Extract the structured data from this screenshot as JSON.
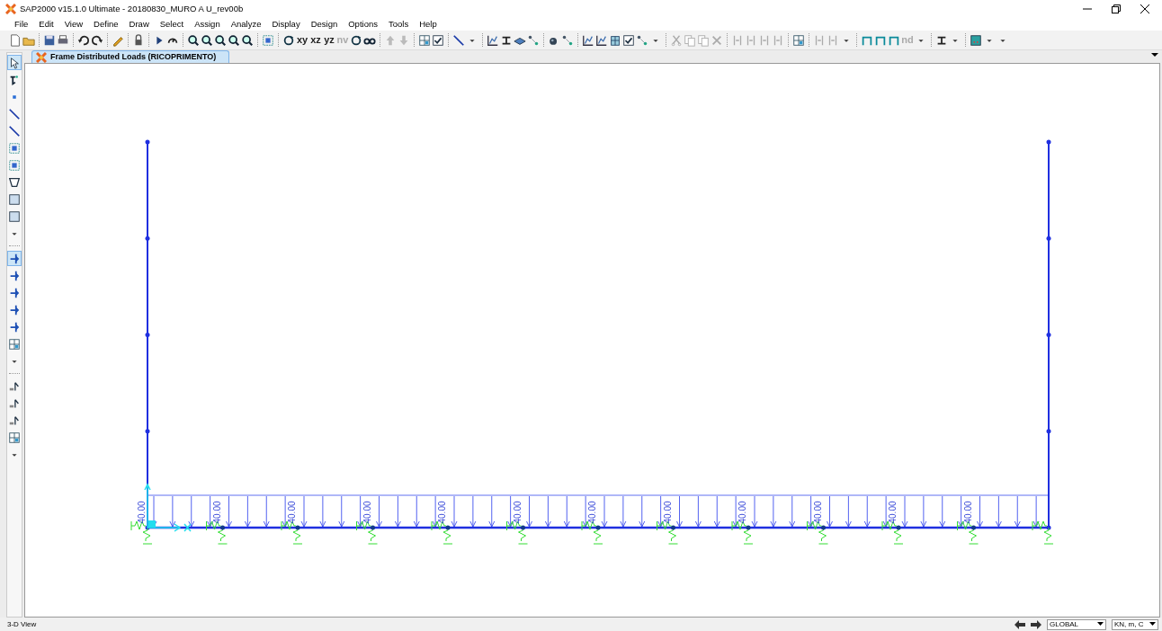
{
  "window": {
    "title": "SAP2000 v15.1.0 Ultimate  - 20180830_MURO A U_rev00b"
  },
  "menu": [
    "File",
    "Edit",
    "View",
    "Define",
    "Draw",
    "Select",
    "Assign",
    "Analyze",
    "Display",
    "Design",
    "Options",
    "Tools",
    "Help"
  ],
  "toolbar": [
    {
      "kind": "doc"
    },
    {
      "kind": "folder"
    },
    {
      "kind": "sep"
    },
    {
      "kind": "disk"
    },
    {
      "kind": "printer"
    },
    {
      "kind": "sep"
    },
    {
      "kind": "undo"
    },
    {
      "kind": "redo"
    },
    {
      "kind": "sep"
    },
    {
      "kind": "pencil"
    },
    {
      "kind": "sep"
    },
    {
      "kind": "lock"
    },
    {
      "kind": "sep"
    },
    {
      "kind": "play"
    },
    {
      "kind": "gauge"
    },
    {
      "kind": "sep"
    },
    {
      "kind": "zoom"
    },
    {
      "kind": "zoom"
    },
    {
      "kind": "zoom"
    },
    {
      "kind": "zoom"
    },
    {
      "kind": "zoom"
    },
    {
      "kind": "sep"
    },
    {
      "kind": "frame"
    },
    {
      "kind": "sep"
    },
    {
      "kind": "rotate"
    },
    {
      "kind": "text",
      "label": "xy",
      "disabled": false
    },
    {
      "kind": "text",
      "label": "xz",
      "disabled": false
    },
    {
      "kind": "text",
      "label": "yz",
      "disabled": false
    },
    {
      "kind": "text",
      "label": "nv",
      "disabled": true
    },
    {
      "kind": "rotate"
    },
    {
      "kind": "glasses"
    },
    {
      "kind": "sep"
    },
    {
      "kind": "up"
    },
    {
      "kind": "down"
    },
    {
      "kind": "sep"
    },
    {
      "kind": "grid"
    },
    {
      "kind": "check"
    },
    {
      "kind": "sep"
    },
    {
      "kind": "line"
    },
    {
      "kind": "caret"
    },
    {
      "kind": "sep"
    },
    {
      "kind": "chart"
    },
    {
      "kind": "ibeam"
    },
    {
      "kind": "layers"
    },
    {
      "kind": "nodes"
    },
    {
      "kind": "sep"
    },
    {
      "kind": "sphere"
    },
    {
      "kind": "nodes"
    },
    {
      "kind": "sep"
    },
    {
      "kind": "chart"
    },
    {
      "kind": "chart"
    },
    {
      "kind": "building"
    },
    {
      "kind": "check"
    },
    {
      "kind": "nodes"
    },
    {
      "kind": "caret"
    },
    {
      "kind": "sep"
    },
    {
      "kind": "scissors"
    },
    {
      "kind": "copy"
    },
    {
      "kind": "copy"
    },
    {
      "kind": "cross"
    },
    {
      "kind": "sep"
    },
    {
      "kind": "bars"
    },
    {
      "kind": "bars"
    },
    {
      "kind": "bars"
    },
    {
      "kind": "bars"
    },
    {
      "kind": "sep"
    },
    {
      "kind": "grid"
    },
    {
      "kind": "sep"
    },
    {
      "kind": "bars"
    },
    {
      "kind": "bars"
    },
    {
      "kind": "caret"
    },
    {
      "kind": "sep"
    },
    {
      "kind": "portal"
    },
    {
      "kind": "portal"
    },
    {
      "kind": "portal"
    },
    {
      "kind": "text",
      "label": "nd",
      "disabled": true
    },
    {
      "kind": "caret"
    },
    {
      "kind": "sep"
    },
    {
      "kind": "ibeam"
    },
    {
      "kind": "caret"
    },
    {
      "kind": "sep"
    },
    {
      "kind": "color"
    },
    {
      "kind": "caret"
    },
    {
      "kind": "caret"
    }
  ],
  "tab": {
    "label": "Frame Distributed Loads (RICOPRIMENTO)",
    "selected": true
  },
  "side_toolbar": [
    {
      "kind": "pointer",
      "selected": true
    },
    {
      "kind": "reshape",
      "selected": false
    },
    {
      "kind": "point",
      "selected": false
    },
    {
      "kind": "line",
      "selected": false
    },
    {
      "kind": "line",
      "selected": false
    },
    {
      "kind": "frame",
      "selected": false
    },
    {
      "kind": "frame",
      "selected": false
    },
    {
      "kind": "poly",
      "selected": false
    },
    {
      "kind": "square",
      "selected": false
    },
    {
      "kind": "square",
      "selected": false
    },
    {
      "kind": "caret",
      "selected": false
    },
    {
      "kind": "sep"
    },
    {
      "kind": "restraint",
      "selected": true
    },
    {
      "kind": "restraint",
      "selected": false
    },
    {
      "kind": "restraint",
      "selected": false
    },
    {
      "kind": "restraint",
      "selected": false
    },
    {
      "kind": "restraint",
      "selected": false
    },
    {
      "kind": "grid",
      "selected": false
    },
    {
      "kind": "caret",
      "selected": false
    },
    {
      "kind": "sep"
    },
    {
      "kind": "select",
      "selected": false
    },
    {
      "kind": "select",
      "selected": false
    },
    {
      "kind": "select",
      "selected": false
    },
    {
      "kind": "grid",
      "selected": false
    },
    {
      "kind": "caret",
      "selected": false
    }
  ],
  "model": {
    "load_labels": [
      "40.00",
      "40.00",
      "40.00",
      "40.00",
      "40.00",
      "40.00",
      "40.00",
      "40.00",
      "40.00",
      "40.00",
      "40.00",
      "40.00"
    ]
  },
  "status_bar": {
    "view": "3-D View",
    "coordinate_system": "GLOBAL",
    "units": "KN, m, C"
  }
}
